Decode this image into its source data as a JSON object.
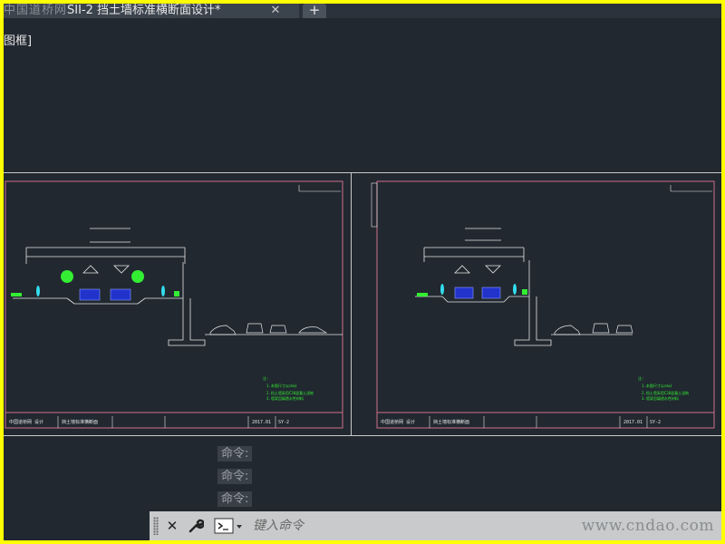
{
  "tab": {
    "watermark": "中国道桥网",
    "title": "SII-2 挡土墙标准横断面设计*",
    "close_glyph": "✕",
    "add_glyph": "+"
  },
  "viewport_label": "图框]",
  "sheets": {
    "left": {
      "number": "SY-2",
      "date": "2017.01"
    },
    "right": {
      "number": "SY-2",
      "date": "2017.01"
    }
  },
  "command_history": [
    "命令:",
    "命令:",
    "命令:"
  ],
  "command_line": {
    "placeholder": "键入命令",
    "close_icon": "close-icon",
    "customize_icon": "wrench-icon",
    "prompt_icon": "command-prompt-icon"
  },
  "site_watermark": "www.cndao.com",
  "colors": {
    "canvas": "#212830",
    "sheet_border": "#d0708a",
    "drawing_lines": "#e6e6e6",
    "annotation": "#33ee33",
    "vehicle": "#2233cc",
    "outer_border": "#ffff00"
  }
}
